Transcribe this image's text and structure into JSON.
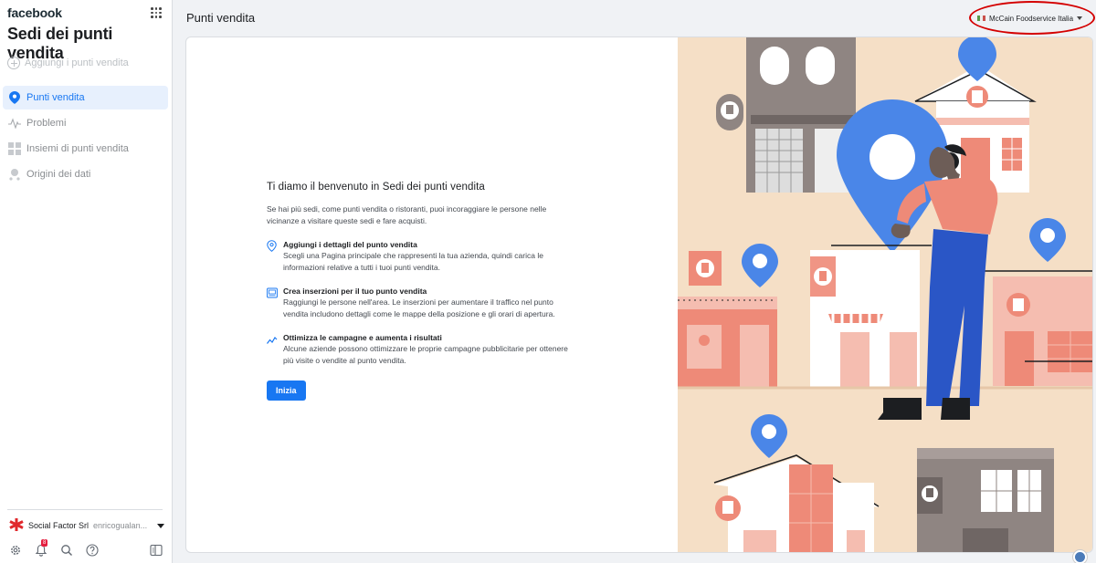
{
  "brand": "facebook",
  "sidebar": {
    "title": "Sedi dei punti vendita",
    "add_label": "Aggiungi i punti vendita",
    "items": [
      {
        "label": "Punti vendita",
        "active": true,
        "icon": "location-pin-icon"
      },
      {
        "label": "Problemi",
        "active": false,
        "icon": "pulse-icon"
      },
      {
        "label": "Insiemi di punti vendita",
        "active": false,
        "icon": "grid-icon"
      },
      {
        "label": "Origini dei dati",
        "active": false,
        "icon": "data-source-icon"
      }
    ],
    "account": {
      "name": "Social Factor Srl",
      "user": "enricogualan..."
    },
    "bottom_icons": [
      "gear-icon",
      "bell-icon",
      "search-icon",
      "help-icon",
      "panel-toggle-icon"
    ],
    "notification_count": "8"
  },
  "header": {
    "title": "Punti vendita",
    "account_switch": "McCain Foodservice Italia"
  },
  "welcome": {
    "title": "Ti diamo il benvenuto in Sedi dei punti vendita",
    "intro": "Se hai più sedi, come punti vendita o ristoranti, puoi incoraggiare le persone nelle vicinanze a visitare queste sedi e fare acquisti.",
    "features": [
      {
        "icon": "location-pin-outline-icon",
        "title": "Aggiungi i dettagli del punto vendita",
        "desc": "Scegli una Pagina principale che rappresenti la tua azienda, quindi carica le informazioni relative a tutti i tuoi punti vendita."
      },
      {
        "icon": "ad-preview-icon",
        "title": "Crea inserzioni per il tuo punto vendita",
        "desc": "Raggiungi le persone nell'area. Le inserzioni per aumentare il traffico nel punto vendita includono dettagli come le mappe della posizione e gli orari di apertura."
      },
      {
        "icon": "trend-chart-icon",
        "title": "Ottimizza le campagne e aumenta i risultati",
        "desc": "Alcune aziende possono ottimizzare le proprie campagne pubblicitarie per ottenere più visite o vendite al punto vendita."
      }
    ],
    "button": "Inizia"
  },
  "colors": {
    "accent": "#1877f2",
    "illustration_bg": "#f5dfc6",
    "salmon": "#ee8a78",
    "pin": "#4a86e8",
    "building_gray": "#8f8582",
    "annotation": "#d40000"
  }
}
